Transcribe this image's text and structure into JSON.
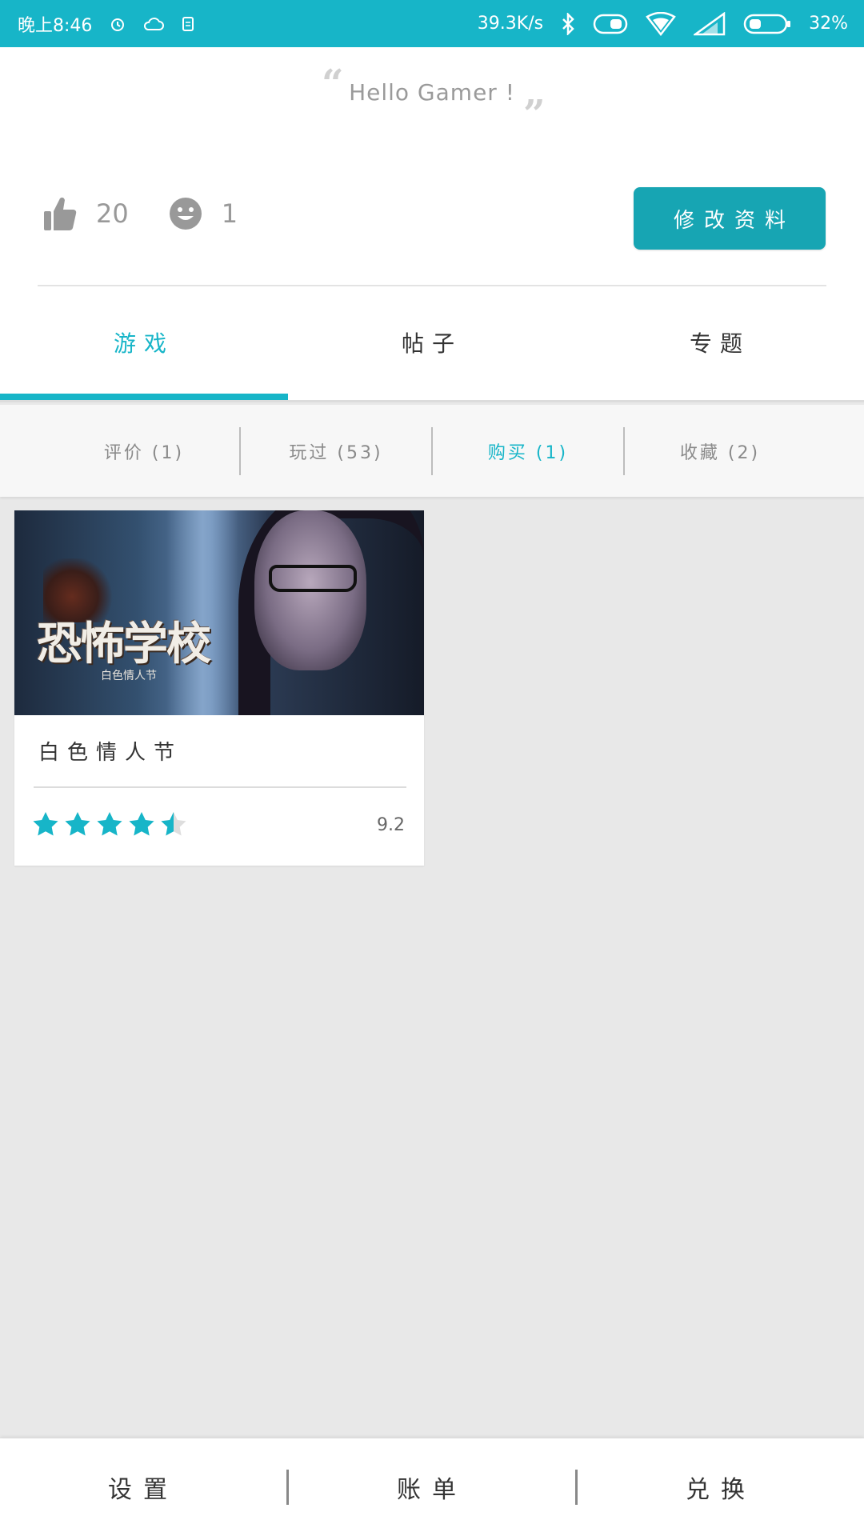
{
  "status_bar": {
    "time": "晚上8:46",
    "net_speed": "39.3K/s",
    "battery": "32%",
    "icons": [
      "alarm-icon",
      "cloud-icon",
      "sim-icon",
      "bluetooth-icon",
      "toggle-icon",
      "wifi-icon",
      "signal-icon",
      "battery-icon"
    ]
  },
  "profile": {
    "greeting": "Hello Gamer !",
    "likes": "20",
    "smiles": "1",
    "edit_button": "修改资料"
  },
  "tabs": [
    {
      "label": "游戏",
      "active": true
    },
    {
      "label": "帖子",
      "active": false
    },
    {
      "label": "专题",
      "active": false
    }
  ],
  "subtabs": [
    {
      "label": "评价 (1)",
      "active": false
    },
    {
      "label": "玩过 (53)",
      "active": false
    },
    {
      "label": "购买 (1)",
      "active": true
    },
    {
      "label": "收藏 (2)",
      "active": false
    }
  ],
  "cards": [
    {
      "image_title": "恐怖学校",
      "image_subtitle": "白色情人节",
      "title": "白色情人节",
      "rating_stars": 4.5,
      "score": "9.2"
    }
  ],
  "bottom_nav": [
    {
      "label": "设置"
    },
    {
      "label": "账单"
    },
    {
      "label": "兑换"
    }
  ],
  "colors": {
    "accent": "#17b5c8",
    "button": "#17a5b3"
  }
}
